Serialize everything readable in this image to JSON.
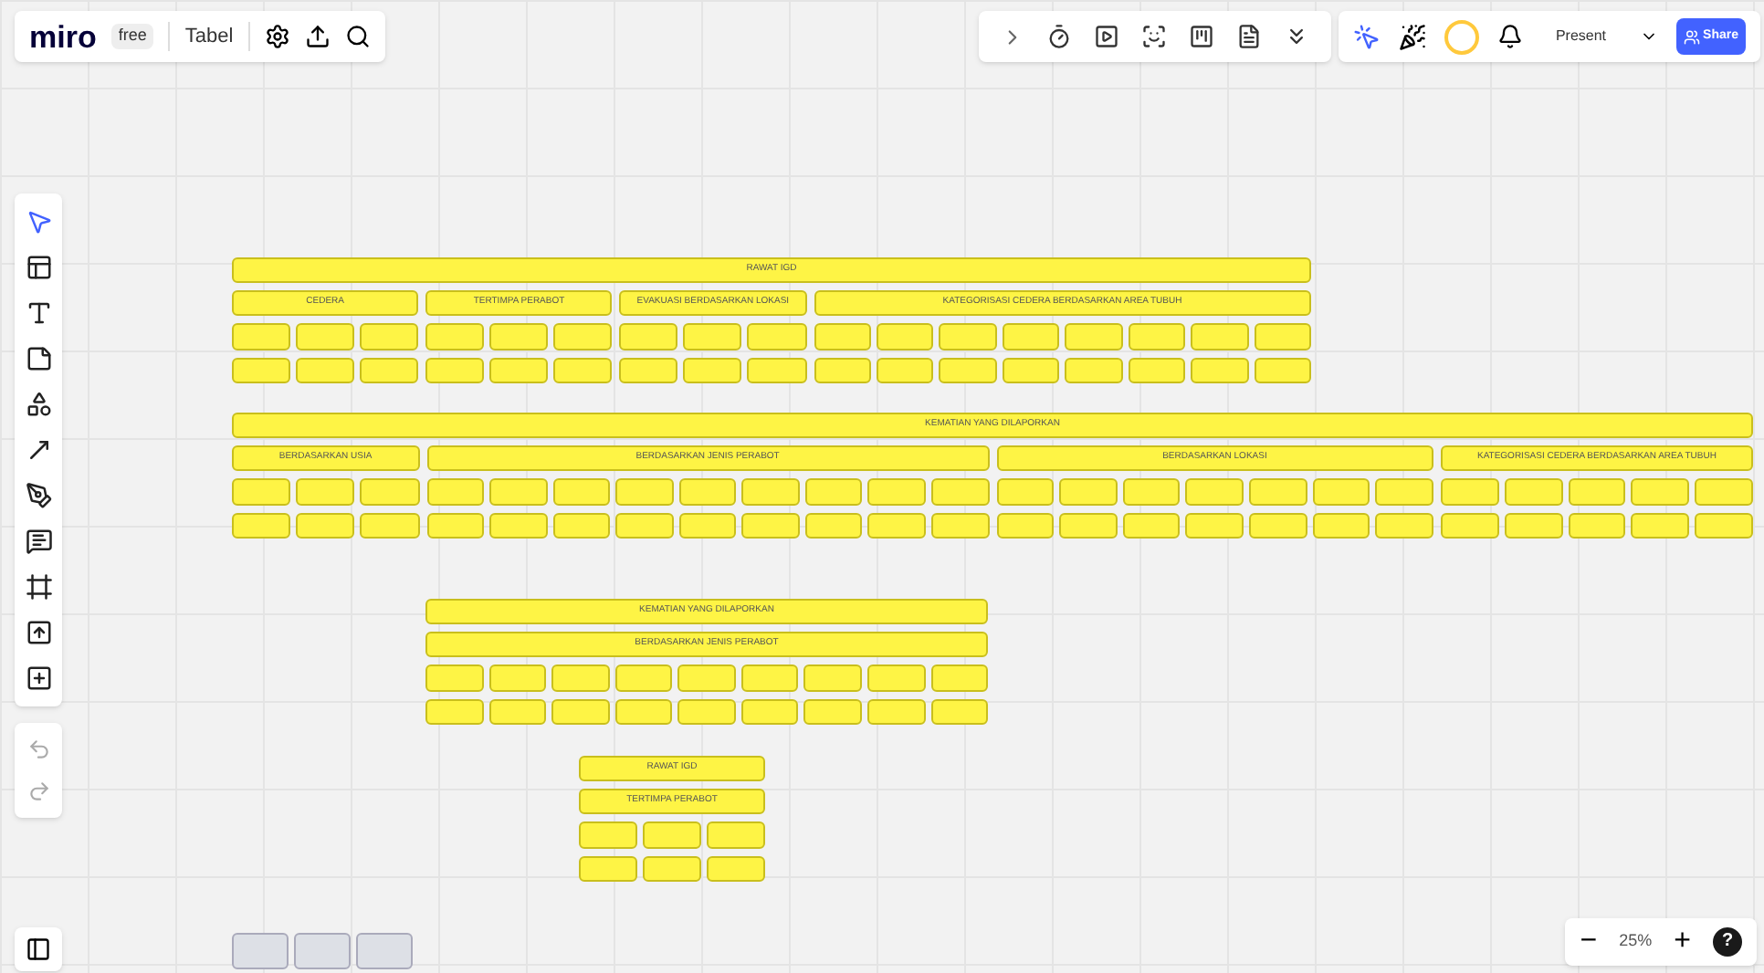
{
  "topbar": {
    "logo": "miro",
    "plan": "free",
    "board_title": "Tabel"
  },
  "actions": {
    "present": "Present",
    "share": "Share"
  },
  "tables": [
    {
      "title": "RAWAT IGD",
      "sections": [
        {
          "title": "CEDERA",
          "columns": [
            {
              "kind": "blank"
            },
            {
              "kind": "blank"
            },
            {
              "kind": "blank"
            }
          ]
        },
        {
          "title": "TERTIMPA PERABOT",
          "columns": [
            {
              "kind": "blank"
            },
            {
              "kind": "blank"
            },
            {
              "kind": "blank"
            }
          ]
        },
        {
          "title": "EVAKUASI BERDASARKAN LOKASI",
          "columns": [
            {
              "kind": "blank"
            },
            {
              "kind": "blank"
            },
            {
              "kind": "blank"
            }
          ]
        },
        {
          "title": "KATEGORISASI CEDERA BERDASARKAN AREA TUBUH",
          "columns": [
            {
              "kind": "blank"
            },
            {
              "kind": "blank"
            },
            {
              "kind": "blank"
            },
            {
              "kind": "blank"
            },
            {
              "kind": "blank"
            },
            {
              "kind": "blank"
            },
            {
              "kind": "blank"
            },
            {
              "kind": "blank"
            }
          ]
        }
      ]
    },
    {
      "title": "KEMATIAN YANG DILAPORKAN",
      "sections": [
        {
          "title": "BERDASARKAN USIA",
          "columns": [
            {
              "kind": "blank"
            },
            {
              "kind": "blank"
            },
            {
              "kind": "blank"
            }
          ]
        },
        {
          "title": "BERDASARKAN JENIS PERABOT",
          "columns": [
            {
              "kind": "blank"
            },
            {
              "kind": "blank"
            },
            {
              "kind": "blank"
            },
            {
              "kind": "blank"
            },
            {
              "kind": "blank"
            },
            {
              "kind": "blank"
            },
            {
              "kind": "blank"
            },
            {
              "kind": "blank"
            },
            {
              "kind": "blank"
            }
          ]
        },
        {
          "title": "BERDASARKAN LOKASI",
          "columns": [
            {
              "kind": "blank"
            },
            {
              "kind": "blank"
            },
            {
              "kind": "blank"
            },
            {
              "kind": "blank"
            },
            {
              "kind": "blank"
            },
            {
              "kind": "blank"
            },
            {
              "kind": "blank"
            }
          ]
        },
        {
          "title": "KATEGORISASI CEDERA BERDASARKAN AREA TUBUH",
          "columns": [
            {
              "kind": "blank"
            },
            {
              "kind": "blank"
            },
            {
              "kind": "blank"
            },
            {
              "kind": "blank"
            },
            {
              "kind": "blank"
            }
          ]
        }
      ]
    },
    {
      "title": "KEMATIAN YANG DILAPORKAN",
      "sections": [
        {
          "title": "BERDASARKAN JENIS PERABOT",
          "columns": [
            {
              "kind": "blank"
            },
            {
              "kind": "blank"
            },
            {
              "kind": "blank"
            },
            {
              "kind": "blank"
            },
            {
              "kind": "blank"
            },
            {
              "kind": "blank"
            },
            {
              "kind": "blank"
            },
            {
              "kind": "blank"
            },
            {
              "kind": "blank"
            }
          ]
        }
      ]
    },
    {
      "title": "RAWAT IGD",
      "sections": [
        {
          "title": "TERTIMPA PERABOT",
          "columns": [
            {
              "kind": "blank"
            },
            {
              "kind": "blank"
            },
            {
              "kind": "blank"
            }
          ]
        }
      ]
    }
  ],
  "grey_cells": [
    {
      "kind": "blank"
    },
    {
      "kind": "blank"
    },
    {
      "kind": "blank"
    }
  ],
  "zoom": {
    "minus": "−",
    "level": "25%",
    "plus": "+",
    "help": "?"
  }
}
